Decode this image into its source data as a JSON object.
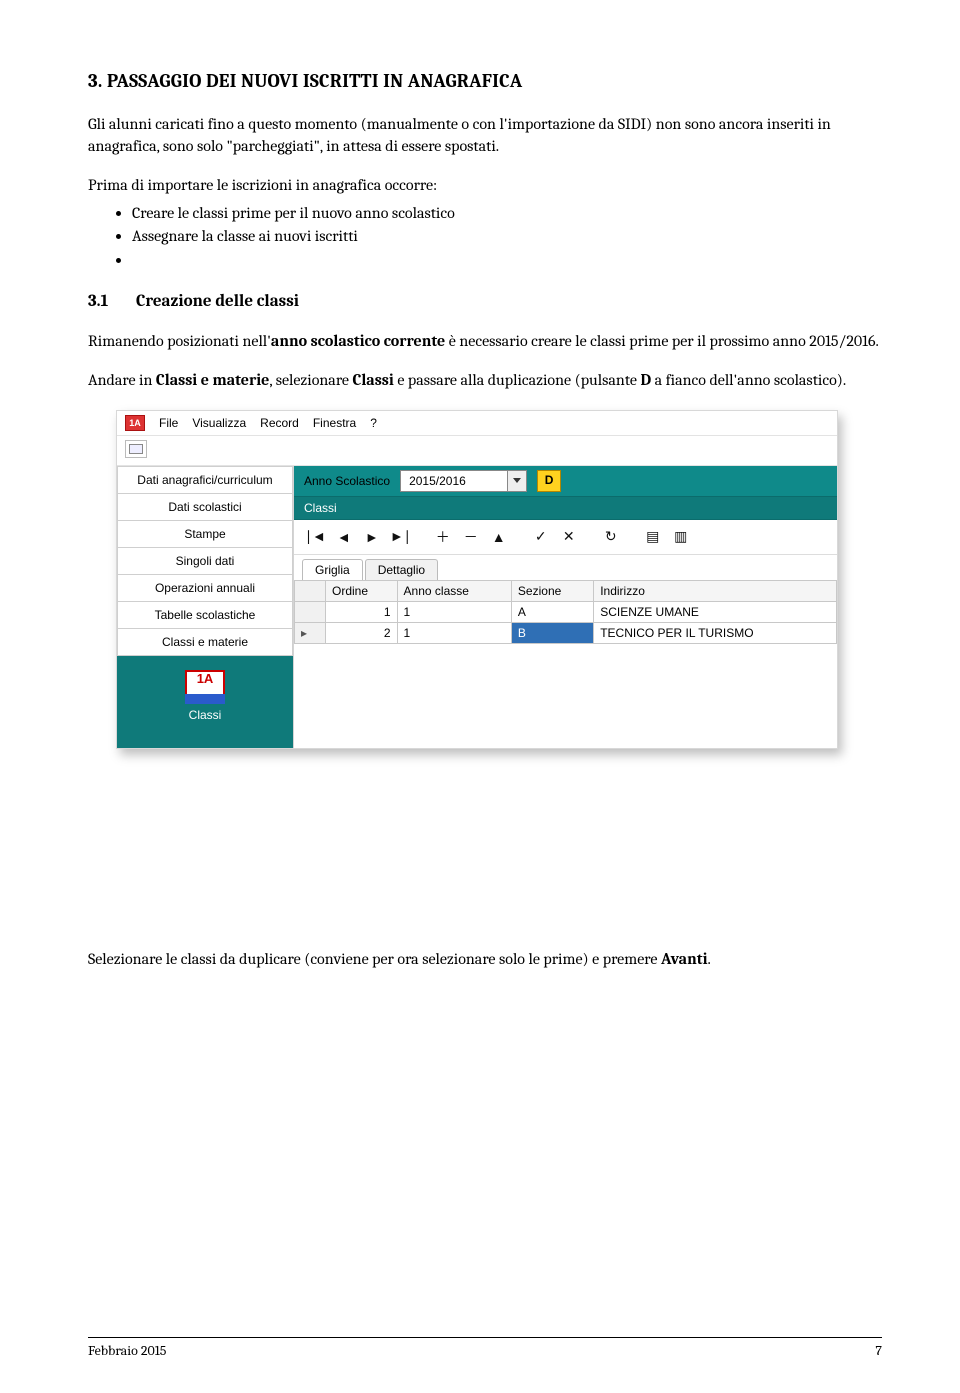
{
  "section": {
    "number": "3.",
    "title": "PASSAGGIO DEI NUOVI ISCRITTI IN ANAGRAFICA"
  },
  "para1": "Gli alunni caricati fino a questo momento (manualmente o con l'importazione da SIDI) non sono ancora inseriti in anagrafica, sono solo \"parcheggiati\", in attesa di essere spostati.",
  "para2_intro": "Prima di importare le iscrizioni in anagrafica occorre:",
  "bullets": [
    "Creare le classi prime per il nuovo anno scolastico",
    "Assegnare la classe ai nuovi iscritti",
    ""
  ],
  "subsection": {
    "number": "3.1",
    "title": "Creazione delle classi"
  },
  "para3_a": "Rimanendo posizionati nell'",
  "para3_b_bold": "anno scolastico corrente",
  "para3_c": " è necessario creare le classi prime per il prossimo anno 2015/2016.",
  "para4_a": "Andare in ",
  "para4_b_bold": "Classi e materie",
  "para4_c": ", selezionare ",
  "para4_d_bold": "Classi",
  "para4_e": " e passare alla duplicazione (pulsante ",
  "para4_f_bold": "D",
  "para4_g": " a fianco dell'anno scolastico).",
  "para5_a": "Selezionare le classi da duplicare (conviene per ora selezionare solo le prime) e premere ",
  "para5_b_bold": "Avanti",
  "para5_c": ".",
  "screenshot": {
    "menu": {
      "items": [
        "File",
        "Visualizza",
        "Record",
        "Finestra",
        "?"
      ],
      "logo_text": "1A"
    },
    "sidebar": {
      "items": [
        "Dati anagrafici/curriculum",
        "Dati scolastici",
        "Stampe",
        "Singoli dati",
        "Operazioni annuali",
        "Tabelle scolastiche",
        "Classi e materie"
      ],
      "lower": {
        "icon_text": "1A",
        "caption": "Classi"
      }
    },
    "main": {
      "anno_label": "Anno Scolastico",
      "anno_value": "2015/2016",
      "d_button": "D",
      "section_label": "Classi",
      "tabs": [
        "Griglia",
        "Dettaglio"
      ],
      "columns": [
        "",
        "Ordine",
        "Anno classe",
        "Sezione",
        "Indirizzo"
      ],
      "rows": [
        {
          "marker": "",
          "ordine": "1",
          "anno": "1",
          "sezione": "A",
          "indirizzo": "SCIENZE UMANE"
        },
        {
          "marker": "▸",
          "ordine": "2",
          "anno": "1",
          "sezione": "B",
          "indirizzo": "TECNICO PER IL TURISMO"
        }
      ],
      "selected_row_index": 1
    }
  },
  "footer": {
    "left": "Febbraio 2015",
    "right": "7"
  }
}
